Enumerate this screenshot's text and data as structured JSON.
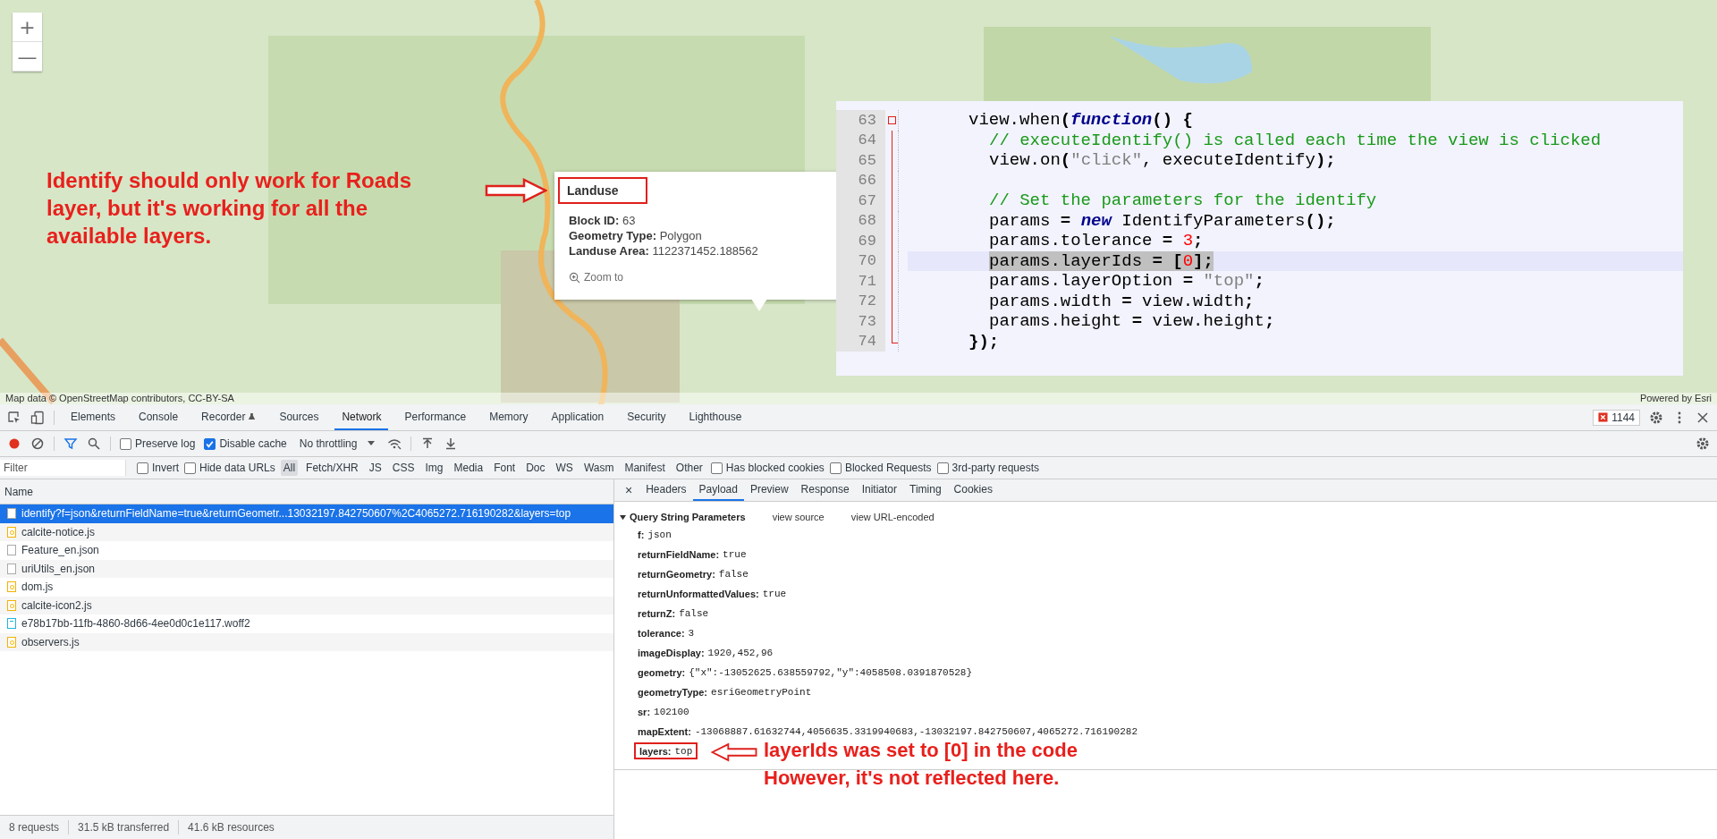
{
  "map": {
    "zoom_controls": [
      "+",
      "—"
    ],
    "attribution": "Map data © OpenStreetMap contributors, CC-BY-SA",
    "powered_by": "Powered by Esri"
  },
  "map_annotation": {
    "lines": [
      "Identify should only work for Roads",
      "layer, but it's working for all the",
      "available layers."
    ]
  },
  "popup": {
    "title": "Landuse",
    "fields": [
      {
        "label": "Block ID:",
        "value": "63"
      },
      {
        "label": "Geometry Type:",
        "value": "Polygon"
      },
      {
        "label": "Landuse Area:",
        "value": "1122371452.188562"
      }
    ],
    "action": "Zoom to"
  },
  "code_editor": {
    "lines": [
      {
        "number": "63",
        "current": false,
        "kind": "fold_start",
        "tokens": [
          {
            "kind": "plain",
            "text": "view.when"
          },
          {
            "kind": "op",
            "text": "("
          },
          {
            "kind": "keyword",
            "text": "function"
          },
          {
            "kind": "op",
            "text": "() {"
          }
        ],
        "children": [
          {
            "number": "64",
            "current": false,
            "kind": "code",
            "tokens": [
              {
                "kind": "comment",
                "text": "// executeIdentify() is called each time the view is clicked"
              }
            ]
          },
          {
            "number": "65",
            "current": false,
            "kind": "code",
            "tokens": [
              {
                "kind": "plain",
                "text": "view.on"
              },
              {
                "kind": "op",
                "text": "("
              },
              {
                "kind": "string",
                "text": "\"click\""
              },
              {
                "kind": "plain",
                "text": ", executeIdentify"
              },
              {
                "kind": "op",
                "text": ");"
              }
            ]
          },
          {
            "number": "66",
            "current": false,
            "kind": "code"
          },
          {
            "number": "67",
            "current": false,
            "kind": "code",
            "tokens": [
              {
                "kind": "comment",
                "text": "// Set the parameters for the identify"
              }
            ]
          },
          {
            "number": "68",
            "current": false,
            "kind": "code",
            "tokens": [
              {
                "kind": "plain",
                "text": "params "
              },
              {
                "kind": "op",
                "text": "= "
              },
              {
                "kind": "keyword",
                "text": "new"
              },
              {
                "kind": "plain",
                "text": " IdentifyParameters"
              },
              {
                "kind": "op",
                "text": "();"
              }
            ]
          },
          {
            "number": "69",
            "current": false,
            "kind": "code",
            "tokens": [
              {
                "kind": "plain",
                "text": "params.tolerance "
              },
              {
                "kind": "op",
                "text": "= "
              },
              {
                "kind": "number",
                "text": "3"
              },
              {
                "kind": "op",
                "text": ";"
              }
            ]
          },
          {
            "number": "70",
            "current": true,
            "kind": "code",
            "tokens": [
              {
                "kind": "plain",
                "text": "params.layerIds "
              },
              {
                "kind": "op",
                "text": "= ["
              },
              {
                "kind": "number",
                "text": "0"
              },
              {
                "kind": "op",
                "text": "];"
              }
            ]
          },
          {
            "number": "71",
            "current": false,
            "kind": "code",
            "tokens": [
              {
                "kind": "plain",
                "text": "params.layerOption "
              },
              {
                "kind": "op",
                "text": "= "
              },
              {
                "kind": "string",
                "text": "\"top\""
              },
              {
                "kind": "op",
                "text": ";"
              }
            ]
          },
          {
            "number": "72",
            "current": false,
            "kind": "code",
            "tokens": [
              {
                "kind": "plain",
                "text": "params.width "
              },
              {
                "kind": "op",
                "text": "="
              },
              {
                "kind": "plain",
                "text": " view.width"
              },
              {
                "kind": "op",
                "text": ";"
              }
            ]
          },
          {
            "number": "73",
            "current": false,
            "kind": "code",
            "tokens": [
              {
                "kind": "plain",
                "text": "params.height "
              },
              {
                "kind": "op",
                "text": "="
              },
              {
                "kind": "plain",
                "text": " view.height"
              },
              {
                "kind": "op",
                "text": ";"
              }
            ]
          }
        ]
      },
      {
        "number": "74",
        "current": false,
        "kind": "fold_end",
        "tokens": [
          {
            "kind": "op",
            "text": "});"
          }
        ]
      }
    ]
  },
  "devtools": {
    "tabs": [
      {
        "label": "Elements",
        "selected": false
      },
      {
        "label": "Console",
        "selected": false
      },
      {
        "label": "Recorder",
        "selected": false,
        "kind": "flask"
      },
      {
        "label": "Sources",
        "selected": false
      },
      {
        "label": "Network",
        "selected": true
      },
      {
        "label": "Performance",
        "selected": false
      },
      {
        "label": "Memory",
        "selected": false
      },
      {
        "label": "Application",
        "selected": false
      },
      {
        "label": "Security",
        "selected": false
      },
      {
        "label": "Lighthouse",
        "selected": false
      }
    ],
    "error_count": "1144",
    "toolbar": {
      "checkboxes": [
        {
          "label": "Preserve log",
          "checked": false
        },
        {
          "label": "Disable cache",
          "checked": true
        }
      ],
      "throttling": "No throttling"
    },
    "filter": {
      "placeholder": "Filter",
      "checkboxes": [
        {
          "label": "Invert",
          "checked": false
        },
        {
          "label": "Hide data URLs",
          "checked": false
        }
      ],
      "types": [
        {
          "label": "All",
          "selected": true
        },
        {
          "label": "Fetch/XHR",
          "selected": false
        },
        {
          "label": "JS",
          "selected": false
        },
        {
          "label": "CSS",
          "selected": false
        },
        {
          "label": "Img",
          "selected": false
        },
        {
          "label": "Media",
          "selected": false
        },
        {
          "label": "Font",
          "selected": false
        },
        {
          "label": "Doc",
          "selected": false
        },
        {
          "label": "WS",
          "selected": false
        },
        {
          "label": "Wasm",
          "selected": false
        },
        {
          "label": "Manifest",
          "selected": false
        },
        {
          "label": "Other",
          "selected": false
        }
      ],
      "more_checkboxes": [
        {
          "label": "Has blocked cookies",
          "checked": false
        },
        {
          "label": "Blocked Requests",
          "checked": false
        },
        {
          "label": "3rd-party requests",
          "checked": false
        }
      ]
    },
    "requests": {
      "column": "Name",
      "rows": [
        {
          "name": "identify?f=json&returnFieldName=true&returnGeometr...13032197.842750607%2C4065272.716190282&layers=top",
          "kind": "doc",
          "selected": true
        },
        {
          "name": "calcite-notice.js",
          "kind": "script",
          "selected": false
        },
        {
          "name": "Feature_en.json",
          "kind": "doc",
          "selected": false
        },
        {
          "name": "uriUtils_en.json",
          "kind": "doc",
          "selected": false
        },
        {
          "name": "dom.js",
          "kind": "script",
          "selected": false
        },
        {
          "name": "calcite-icon2.js",
          "kind": "script",
          "selected": false
        },
        {
          "name": "e78b17bb-11fb-4860-8d66-4ee0d0c1e117.woff2",
          "kind": "font",
          "selected": false
        },
        {
          "name": "observers.js",
          "kind": "script",
          "selected": false
        }
      ]
    },
    "summary": [
      "8 requests",
      "31.5 kB transferred",
      "41.6 kB resources"
    ],
    "detail": {
      "close": "×",
      "tabs": [
        {
          "label": "Headers",
          "selected": false
        },
        {
          "label": "Payload",
          "selected": true
        },
        {
          "label": "Preview",
          "selected": false
        },
        {
          "label": "Response",
          "selected": false
        },
        {
          "label": "Initiator",
          "selected": false
        },
        {
          "label": "Timing",
          "selected": false
        },
        {
          "label": "Cookies",
          "selected": false
        }
      ],
      "section": {
        "title": "Query String Parameters",
        "expanded": true,
        "links": [
          "view source",
          "view URL-encoded"
        ],
        "params": [
          {
            "key": "f:",
            "value": "json",
            "boxed": false
          },
          {
            "key": "returnFieldName:",
            "value": "true",
            "boxed": false
          },
          {
            "key": "returnGeometry:",
            "value": "false",
            "boxed": false
          },
          {
            "key": "returnUnformattedValues:",
            "value": "true",
            "boxed": false
          },
          {
            "key": "returnZ:",
            "value": "false",
            "boxed": false
          },
          {
            "key": "tolerance:",
            "value": "3",
            "boxed": false
          },
          {
            "key": "imageDisplay:",
            "value": "1920,452,96",
            "boxed": false
          },
          {
            "key": "geometry:",
            "value": "{\"x\":-13052625.638559792,\"y\":4058508.0391870528}",
            "boxed": false
          },
          {
            "key": "geometryType:",
            "value": "esriGeometryPoint",
            "boxed": false
          },
          {
            "key": "sr:",
            "value": "102100",
            "boxed": false
          },
          {
            "key": "mapExtent:",
            "value": "-13068887.61632744,4056635.3319940683,-13032197.842750607,4065272.716190282",
            "boxed": false
          },
          {
            "key": "layers:",
            "value": "top",
            "boxed": true
          }
        ]
      }
    },
    "annotation": {
      "lines": [
        "layerIds was set to [0] in the code",
        "However, it's not reflected here."
      ]
    }
  }
}
